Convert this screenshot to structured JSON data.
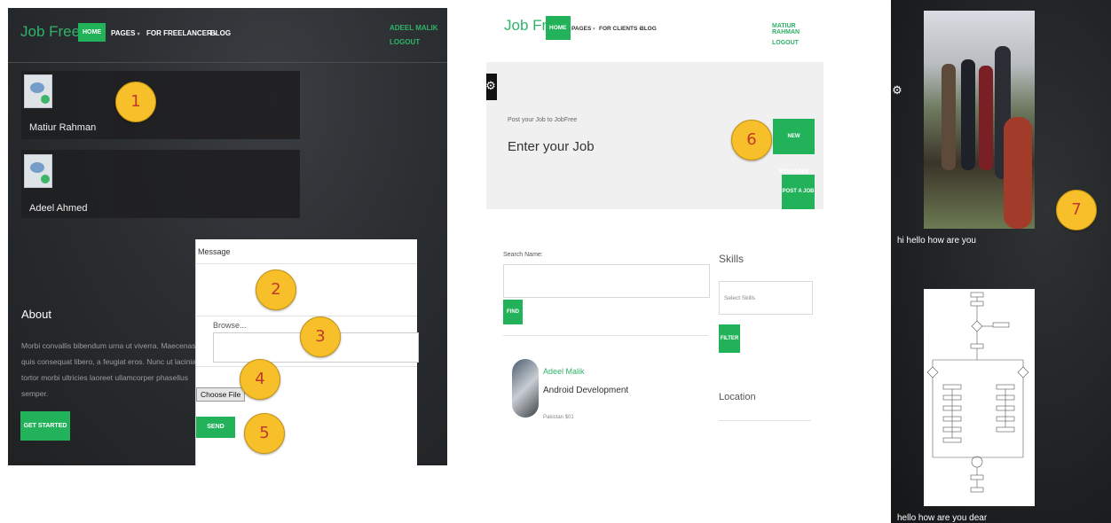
{
  "panel1": {
    "brand": "Job Free",
    "nav": {
      "home": "HOME",
      "pages": "PAGES",
      "freelancer": "FOR FREELANCER",
      "blog": "BLOG"
    },
    "user": {
      "name": "ADEEL MALIK",
      "logout": "LOGOUT"
    },
    "contacts": [
      {
        "name": "Matiur Rahman"
      },
      {
        "name": "Adeel Ahmed"
      }
    ],
    "about": {
      "title": "About",
      "text": "Morbi convallis bibendum urna ut viverra. Maecenas quis consequat libero, a feugiat eros. Nunc ut lacinia tortor morbi ultricies laoreet ullamcorper phasellus semper.",
      "button": "GET STARTED"
    },
    "message": {
      "label": "Message",
      "browse_label": "Browse...",
      "choose_file": "Choose File",
      "send": "SEND"
    }
  },
  "panel2": {
    "brand": "Job Free",
    "nav": {
      "home": "HOME",
      "pages": "PAGES",
      "clients": "FOR CLIENTS",
      "blog": "BLOG"
    },
    "user": {
      "name": "MATIUR RAHMAN",
      "logout": "LOGOUT"
    },
    "post": {
      "caption": "Post your Job to JobFree",
      "heading": "Enter your Job"
    },
    "new_messages": "NEW MESSAGES",
    "post_job": "POST A JOB",
    "search": {
      "label": "Search Name:",
      "find": "FIND"
    },
    "skills": {
      "title": "Skills",
      "placeholder": "Select Skills",
      "filter": "FILTER"
    },
    "result": {
      "name": "Adeel Malik",
      "role": "Android Development",
      "meta": "Pakistan  $01"
    },
    "location": "Location"
  },
  "panel3": {
    "messages": [
      {
        "text": "hi hello how are you"
      },
      {
        "text": "hello how are you dear"
      }
    ]
  },
  "markers": [
    "1",
    "2",
    "3",
    "4",
    "5",
    "6",
    "7"
  ],
  "colors": {
    "accent": "#22b35a",
    "marker": "#f7c02b",
    "marker_text": "#c0392b",
    "dark_bg": "#2a2d30"
  }
}
